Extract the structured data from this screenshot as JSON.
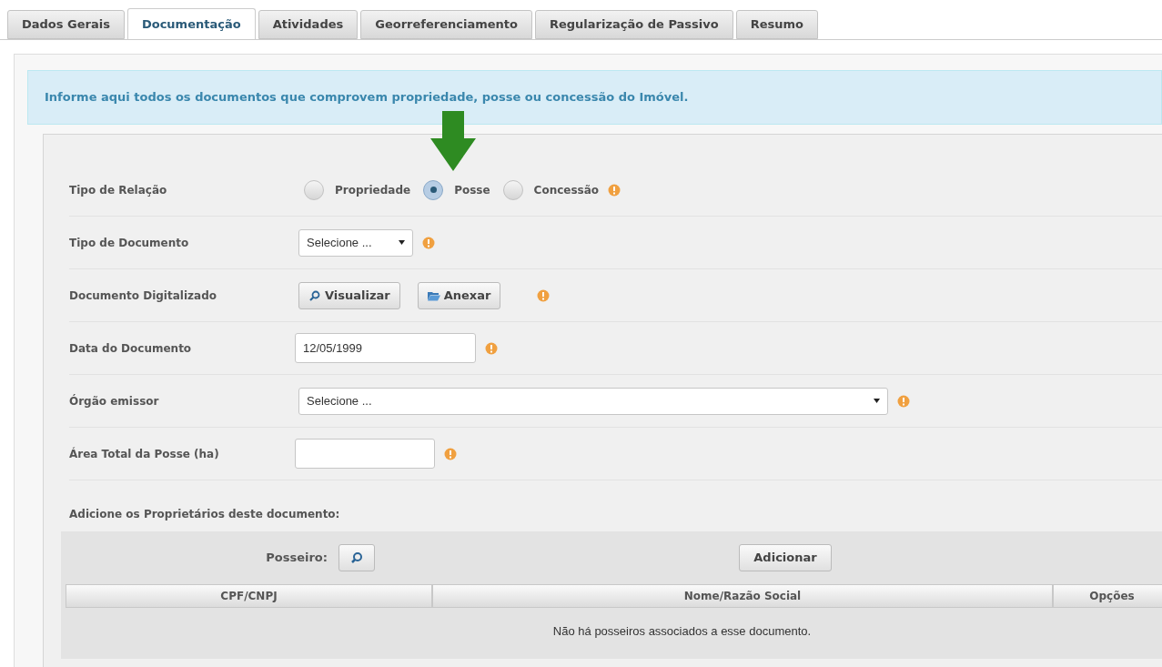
{
  "tabs": [
    {
      "label": "Dados Gerais",
      "selected": false
    },
    {
      "label": "Documentação",
      "selected": true
    },
    {
      "label": "Atividades",
      "selected": false
    },
    {
      "label": "Georreferenciamento",
      "selected": false
    },
    {
      "label": "Regularização de Passivo",
      "selected": false
    },
    {
      "label": "Resumo",
      "selected": false
    }
  ],
  "info_banner": "Informe aqui todos os documentos que comprovem propriedade, posse ou concessão do Imóvel.",
  "form": {
    "rows": [
      {
        "kind": "radio",
        "label": "Tipo de Relação",
        "options": [
          {
            "label": "Propriedade",
            "selected": false
          },
          {
            "label": "Posse",
            "selected": true
          },
          {
            "label": "Concessão",
            "selected": false
          }
        ]
      },
      {
        "kind": "select",
        "label": "Tipo de Documento",
        "value": "Selecione ..."
      },
      {
        "kind": "buttons",
        "label": "Documento Digitalizado",
        "buttons": [
          {
            "label": "Visualizar"
          },
          {
            "label": "Anexar"
          }
        ]
      },
      {
        "kind": "input",
        "label": "Data do Documento",
        "value": "12/05/1999"
      },
      {
        "kind": "select",
        "label": "Órgão emissor",
        "value": "Selecione ..."
      },
      {
        "kind": "input",
        "label": "Área Total da Posse (ha)",
        "value": ""
      }
    ]
  },
  "owners": {
    "heading": "Adicione os Proprietários deste documento:",
    "search_label": "Posseiro:",
    "add_button": "Adicionar",
    "table": {
      "columns": [
        "CPF/CNPJ",
        "Nome/Razão Social",
        "Opções"
      ],
      "empty_message": "Não há posseiros associados a esse documento."
    }
  }
}
